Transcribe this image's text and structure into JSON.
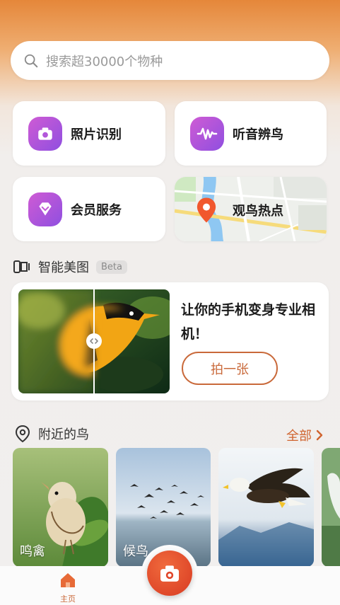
{
  "search": {
    "placeholder": "搜索超30000个物种"
  },
  "features": [
    {
      "label": "照片识别",
      "icon": "camera-icon"
    },
    {
      "label": "听音辨鸟",
      "icon": "sound-wave-icon"
    },
    {
      "label": "会员服务",
      "icon": "diamond-icon"
    },
    {
      "label": "观鸟热点",
      "icon": "map-pin-icon"
    }
  ],
  "smart_photo": {
    "title": "智能美图",
    "badge": "Beta",
    "promo_text": "让你的手机变身专业相机！",
    "button": "拍一张"
  },
  "nearby": {
    "title": "附近的鸟",
    "all_link": "全部",
    "tiles": [
      {
        "caption": "鸣禽"
      },
      {
        "caption": "候鸟"
      },
      {
        "caption": ""
      },
      {
        "caption": ""
      }
    ]
  },
  "tabbar": {
    "home_label": "主页"
  },
  "colors": {
    "accent": "#d0642f",
    "badge_gradient_start": "#cf5bd4",
    "badge_gradient_end": "#8f4fe0",
    "map_pin": "#f1582e"
  }
}
